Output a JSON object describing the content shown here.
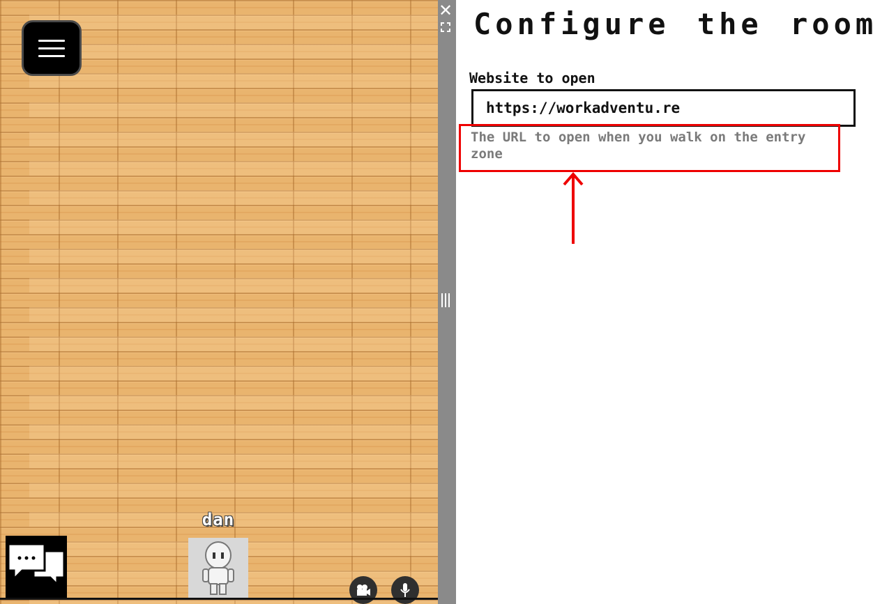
{
  "game": {
    "player_name": "dan",
    "menu_icon": "hamburger-icon",
    "chat_icon": "chat-bubbles-icon",
    "camera_icon": "video-camera-icon",
    "mic_icon": "microphone-icon"
  },
  "sidebar": {
    "close_label": "✕"
  },
  "panel": {
    "title": "Configure the room",
    "website_label": "Website to open",
    "website_value": "https://workadventu.re",
    "help_text": "The URL to open when you walk on the entry zone"
  },
  "colors": {
    "floor": "#e9b46e",
    "highlight": "#e00000",
    "help_text": "#7a7a7a"
  }
}
